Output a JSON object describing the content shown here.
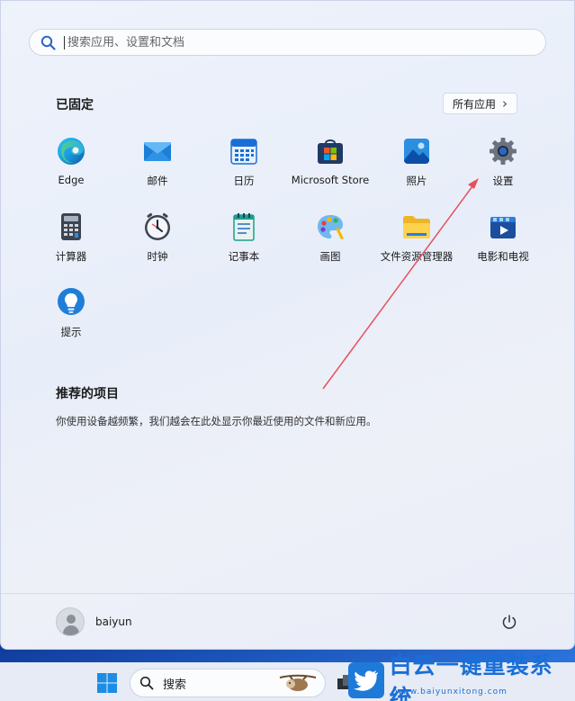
{
  "search": {
    "placeholder": "搜索应用、设置和文档"
  },
  "pinned": {
    "title": "已固定",
    "all_apps_label": "所有应用",
    "all_apps_chevron": "›",
    "apps": [
      {
        "label": "Edge",
        "icon": "edge-icon"
      },
      {
        "label": "邮件",
        "icon": "mail-icon"
      },
      {
        "label": "日历",
        "icon": "calendar-icon"
      },
      {
        "label": "Microsoft Store",
        "icon": "store-icon"
      },
      {
        "label": "照片",
        "icon": "photos-icon"
      },
      {
        "label": "设置",
        "icon": "gear-icon"
      },
      {
        "label": "计算器",
        "icon": "calculator-icon"
      },
      {
        "label": "时钟",
        "icon": "clock-icon"
      },
      {
        "label": "记事本",
        "icon": "notepad-icon"
      },
      {
        "label": "画图",
        "icon": "paint-icon"
      },
      {
        "label": "文件资源管理器",
        "icon": "folder-icon"
      },
      {
        "label": "电影和电视",
        "icon": "movies-icon"
      },
      {
        "label": "提示",
        "icon": "tips-icon"
      }
    ]
  },
  "recommended": {
    "title": "推荐的项目",
    "empty_text": "你使用设备越频繁，我们越会在此处显示你最近使用的文件和新应用。"
  },
  "user": {
    "name": "baiyun"
  },
  "taskbar": {
    "search_label": "搜索"
  },
  "watermark": {
    "title": "白云一键重装系统",
    "url": "www.baiyunxitong.com"
  },
  "colors": {
    "accent": "#1a6fd6",
    "annotation_arrow": "#e8505b"
  }
}
